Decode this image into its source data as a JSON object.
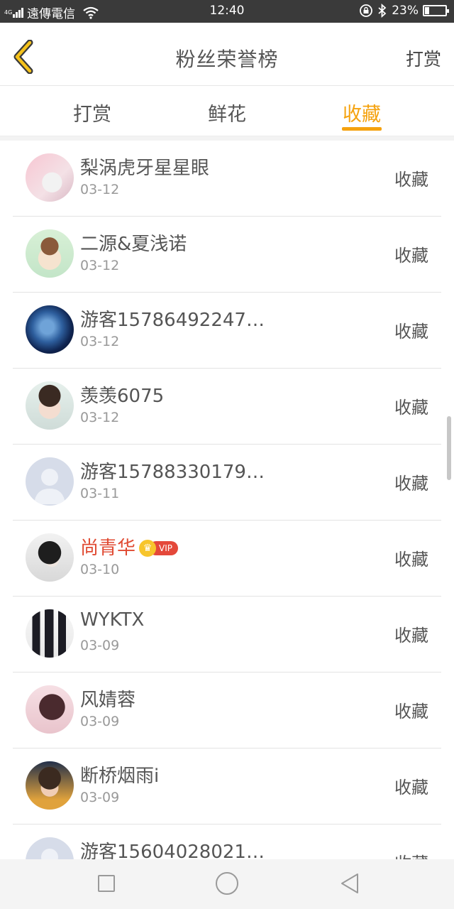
{
  "status_bar": {
    "network": "4G",
    "carrier": "遠傳電信",
    "time": "12:40",
    "battery": "23%",
    "battery_level": 0.23
  },
  "header": {
    "title": "粉丝荣誉榜",
    "action": "打赏"
  },
  "tabs": [
    {
      "label": "打赏",
      "active": false
    },
    {
      "label": "鲜花",
      "active": false
    },
    {
      "label": "收藏",
      "active": true
    }
  ],
  "fans": [
    {
      "name": "梨涡虎牙星星眼",
      "date": "03-12",
      "action": "收藏",
      "vip": false
    },
    {
      "name": "二源&夏浅诺",
      "date": "03-12",
      "action": "收藏",
      "vip": false
    },
    {
      "name": "游客15786492247…",
      "date": "03-12",
      "action": "收藏",
      "vip": false
    },
    {
      "name": "羡羡6075",
      "date": "03-12",
      "action": "收藏",
      "vip": false
    },
    {
      "name": "游客15788330179…",
      "date": "03-11",
      "action": "收藏",
      "vip": false
    },
    {
      "name": "尚青华",
      "date": "03-10",
      "action": "收藏",
      "vip": true,
      "vip_label": "VIP"
    },
    {
      "name": "WYKTX",
      "date": "03-09",
      "action": "收藏",
      "vip": false
    },
    {
      "name": "风婧蓉",
      "date": "03-09",
      "action": "收藏",
      "vip": false
    },
    {
      "name": "断桥烟雨i",
      "date": "03-09",
      "action": "收藏",
      "vip": false
    },
    {
      "name": "游客15604028021…",
      "date": "",
      "action": "收藏",
      "vip": false
    }
  ],
  "colors": {
    "accent": "#f5a20e",
    "vip_name": "#e04a32",
    "vip_tag": "#e4483a"
  },
  "icons": {
    "back": "chevron-left-icon",
    "wifi": "wifi-icon",
    "bluetooth": "bluetooth-icon",
    "rotation_lock": "rotation-lock-icon",
    "battery": "battery-icon",
    "nav_recent": "square-icon",
    "nav_home": "circle-icon",
    "nav_back": "triangle-back-icon"
  }
}
